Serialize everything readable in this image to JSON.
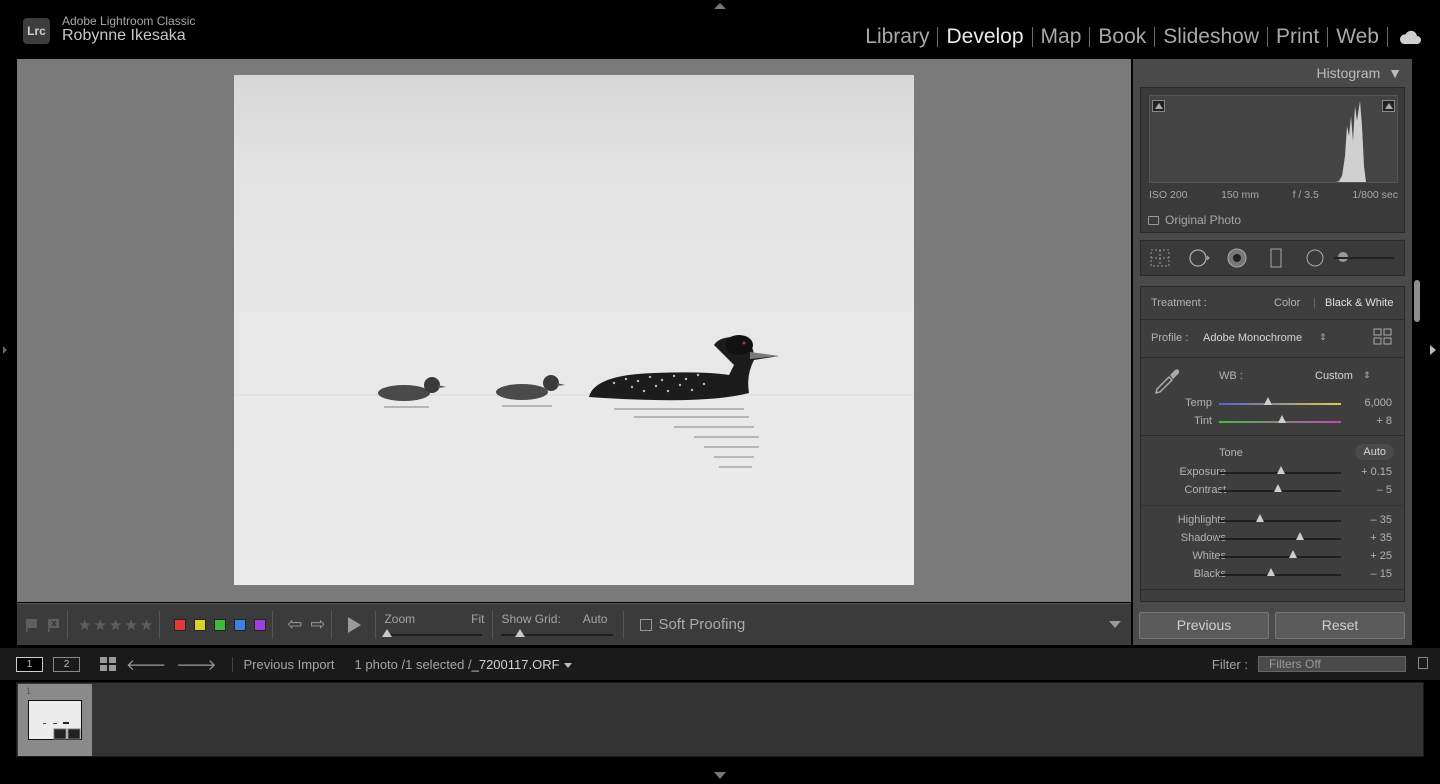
{
  "app": {
    "logo": "Lrc",
    "name": "Adobe Lightroom Classic",
    "user": "Robynne Ikesaka"
  },
  "modules": [
    {
      "label": "Library",
      "active": false
    },
    {
      "label": "Develop",
      "active": true
    },
    {
      "label": "Map",
      "active": false
    },
    {
      "label": "Book",
      "active": false
    },
    {
      "label": "Slideshow",
      "active": false
    },
    {
      "label": "Print",
      "active": false
    },
    {
      "label": "Web",
      "active": false
    }
  ],
  "icons": {
    "cloud": "cloud-icon",
    "flag": "flag-icon",
    "reject": "reject-flag-icon",
    "eyedropper": "eyedropper-icon",
    "grid": "grid-view-icon",
    "profile_browser": "profile-browser-icon"
  },
  "toolbar": {
    "zoom_label": "Zoom",
    "zoom_value": "Fit",
    "show_grid_label": "Show Grid:",
    "show_grid_value": "Auto",
    "soft_proofing": "Soft Proofing",
    "color_labels": [
      "#e03a3a",
      "#d8d12a",
      "#3fba3f",
      "#3f7fe0",
      "#9a3fe0"
    ]
  },
  "histogram": {
    "title": "Histogram",
    "iso": "ISO 200",
    "focal": "150 mm",
    "aperture": "f / 3.5",
    "shutter": "1/800 sec",
    "original_photo": "Original Photo"
  },
  "basic": {
    "treatment_label": "Treatment :",
    "treatment_color": "Color",
    "treatment_bw": "Black & White",
    "profile_label": "Profile :",
    "profile_value": "Adobe Monochrome",
    "wb_label": "WB :",
    "wb_value": "Custom",
    "temp": {
      "label": "Temp",
      "value": "6,000",
      "pos": 0.4
    },
    "tint": {
      "label": "Tint",
      "value": "+ 8",
      "pos": 0.52
    },
    "tone_label": "Tone",
    "auto_label": "Auto",
    "exposure": {
      "label": "Exposure",
      "value": "+ 0.15",
      "pos": 0.51
    },
    "contrast": {
      "label": "Contrast",
      "value": "– 5",
      "pos": 0.48
    },
    "highlights": {
      "label": "Highlights",
      "value": "– 35",
      "pos": 0.34
    },
    "shadows": {
      "label": "Shadows",
      "value": "+ 35",
      "pos": 0.66
    },
    "whites": {
      "label": "Whites",
      "value": "+ 25",
      "pos": 0.61
    },
    "blacks": {
      "label": "Blacks",
      "value": "– 15",
      "pos": 0.43
    }
  },
  "buttons": {
    "previous": "Previous",
    "reset": "Reset"
  },
  "filmbar": {
    "screen1": "1",
    "screen2": "2",
    "source": "Previous Import",
    "count": "1 photo /1 selected /",
    "filename": "_7200117.ORF",
    "filter_label": "Filter :",
    "filter_value": "Filters Off"
  },
  "filmstrip": {
    "thumb_index": "1"
  }
}
